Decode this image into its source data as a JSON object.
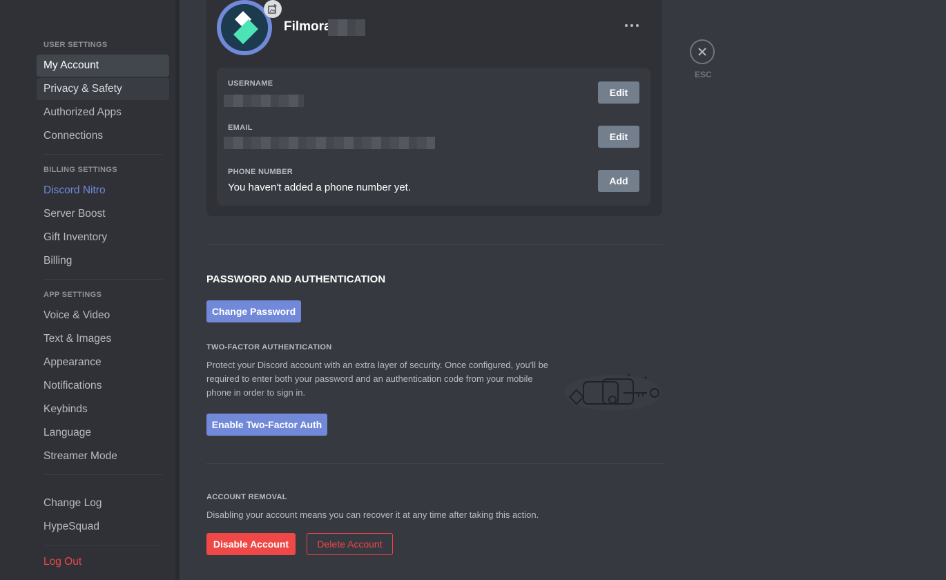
{
  "sidebar": {
    "user_header": "USER SETTINGS",
    "user_items": [
      {
        "label": "My Account"
      },
      {
        "label": "Privacy & Safety"
      },
      {
        "label": "Authorized Apps"
      },
      {
        "label": "Connections"
      }
    ],
    "billing_header": "BILLING SETTINGS",
    "billing_items": [
      {
        "label": "Discord Nitro"
      },
      {
        "label": "Server Boost"
      },
      {
        "label": "Gift Inventory"
      },
      {
        "label": "Billing"
      }
    ],
    "app_header": "APP SETTINGS",
    "app_items": [
      {
        "label": "Voice & Video"
      },
      {
        "label": "Text & Images"
      },
      {
        "label": "Appearance"
      },
      {
        "label": "Notifications"
      },
      {
        "label": "Keybinds"
      },
      {
        "label": "Language"
      },
      {
        "label": "Streamer Mode"
      }
    ],
    "other_items": [
      {
        "label": "Change Log"
      },
      {
        "label": "HypeSquad"
      }
    ],
    "logout_label": "Log Out"
  },
  "account_card": {
    "display_name": "Filmora",
    "username_label": "USERNAME",
    "username_edit": "Edit",
    "email_label": "EMAIL",
    "email_edit": "Edit",
    "phone_label": "PHONE NUMBER",
    "phone_value": "You haven't added a phone number yet.",
    "phone_add": "Add"
  },
  "password_section": {
    "title": "PASSWORD AND AUTHENTICATION",
    "change_password": "Change Password",
    "twofa_title": "TWO-FACTOR AUTHENTICATION",
    "twofa_description": "Protect your Discord account with an extra layer of security. Once configured, you'll be required to enter both your password and an authentication code from your mobile phone in order to sign in.",
    "enable_twofa": "Enable Two-Factor Auth"
  },
  "account_removal": {
    "title": "ACCOUNT REMOVAL",
    "description": "Disabling your account means you can recover it at any time after taking this action.",
    "disable": "Disable Account",
    "delete": "Delete Account"
  },
  "close": {
    "label": "ESC"
  },
  "colors": {
    "background": "#36393f",
    "sidebar": "#2f3136",
    "brand": "#7289da",
    "danger": "#f04747",
    "button_grey": "#747f8d"
  }
}
